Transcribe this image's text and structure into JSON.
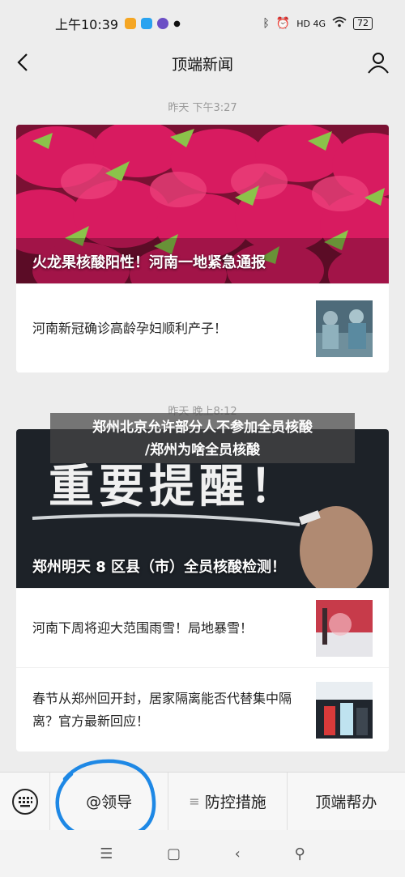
{
  "status_bar": {
    "time": "上午10:39",
    "battery": "72",
    "network": "HD 4G"
  },
  "header": {
    "title": "顶端新闻"
  },
  "groups": [
    {
      "timestamp": "昨天 下午3:27",
      "hero_title": "火龙果核酸阳性！河南一地紧急通报",
      "items": [
        {
          "text": "河南新冠确诊高龄孕妇顺利产子！"
        }
      ]
    },
    {
      "timestamp": "昨天 晚上8:12",
      "hero_title": "郑州明天 8 区县（市）全员核酸检测！",
      "hero_board_text": "重要提醒！",
      "items": [
        {
          "text": "河南下周将迎大范围雨雪！局地暴雪！"
        },
        {
          "text": "春节从郑州回开封，居家隔离能否代替集中隔离？官方最新回应！"
        }
      ]
    }
  ],
  "overlay_headline": {
    "line1": "郑州北京允许部分人不参加全员核酸",
    "line2": "/郑州为啥全员核酸"
  },
  "menu": {
    "items": [
      {
        "prefix": "@",
        "label": "领导"
      },
      {
        "prefix": "≡",
        "label": "防控措施"
      },
      {
        "prefix": "",
        "label": "顶端帮办"
      }
    ]
  },
  "colors": {
    "annotation_circle": "#1e88e5",
    "background": "#ededed"
  },
  "icons": {
    "back": "back-arrow-icon",
    "profile": "person-icon",
    "keyboard": "keyboard-icon"
  }
}
